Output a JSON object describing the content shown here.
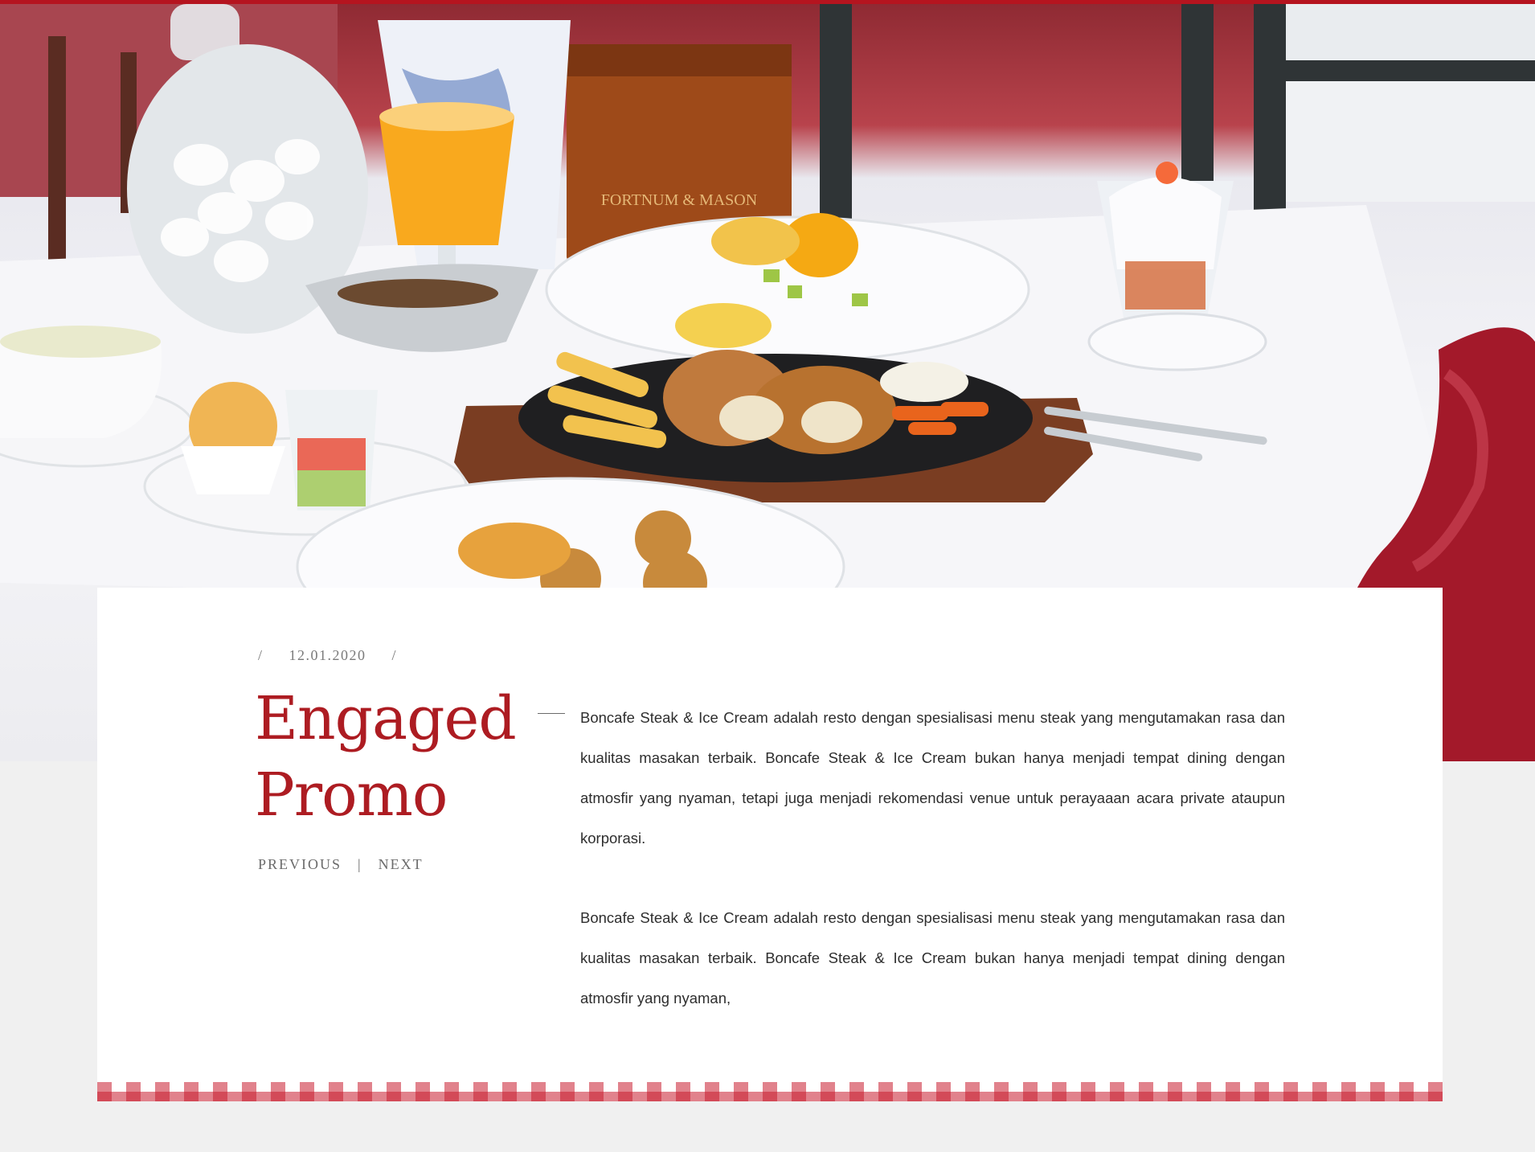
{
  "colors": {
    "accent": "#ad1c22",
    "top_bar": "#b5141f",
    "page_bg": "#f0f0f0",
    "card_bg": "#ffffff",
    "gingham": "#c81c2e"
  },
  "hero": {
    "alt": "Restaurant table with steak, fries and desserts"
  },
  "post": {
    "date": "12.01.2020",
    "separator": "/",
    "title": "Engaged Promo",
    "paragraphs": [
      "Boncafe Steak & Ice Cream adalah resto dengan spesialisasi menu steak yang mengutamakan rasa dan kualitas masakan terbaik. Boncafe Steak & Ice Cream bukan hanya menjadi tempat dining dengan atmosfir yang nyaman, tetapi juga menjadi rekomendasi venue untuk perayaaan acara private ataupun korporasi.",
      "Boncafe Steak & Ice Cream adalah resto dengan spesialisasi menu steak yang mengutamakan rasa dan kualitas masakan terbaik. Boncafe Steak & Ice Cream bukan hanya menjadi tempat dining dengan atmosfir yang nyaman,"
    ]
  },
  "pager": {
    "previous": "PREVIOUS",
    "divider": "|",
    "next": "NEXT"
  }
}
